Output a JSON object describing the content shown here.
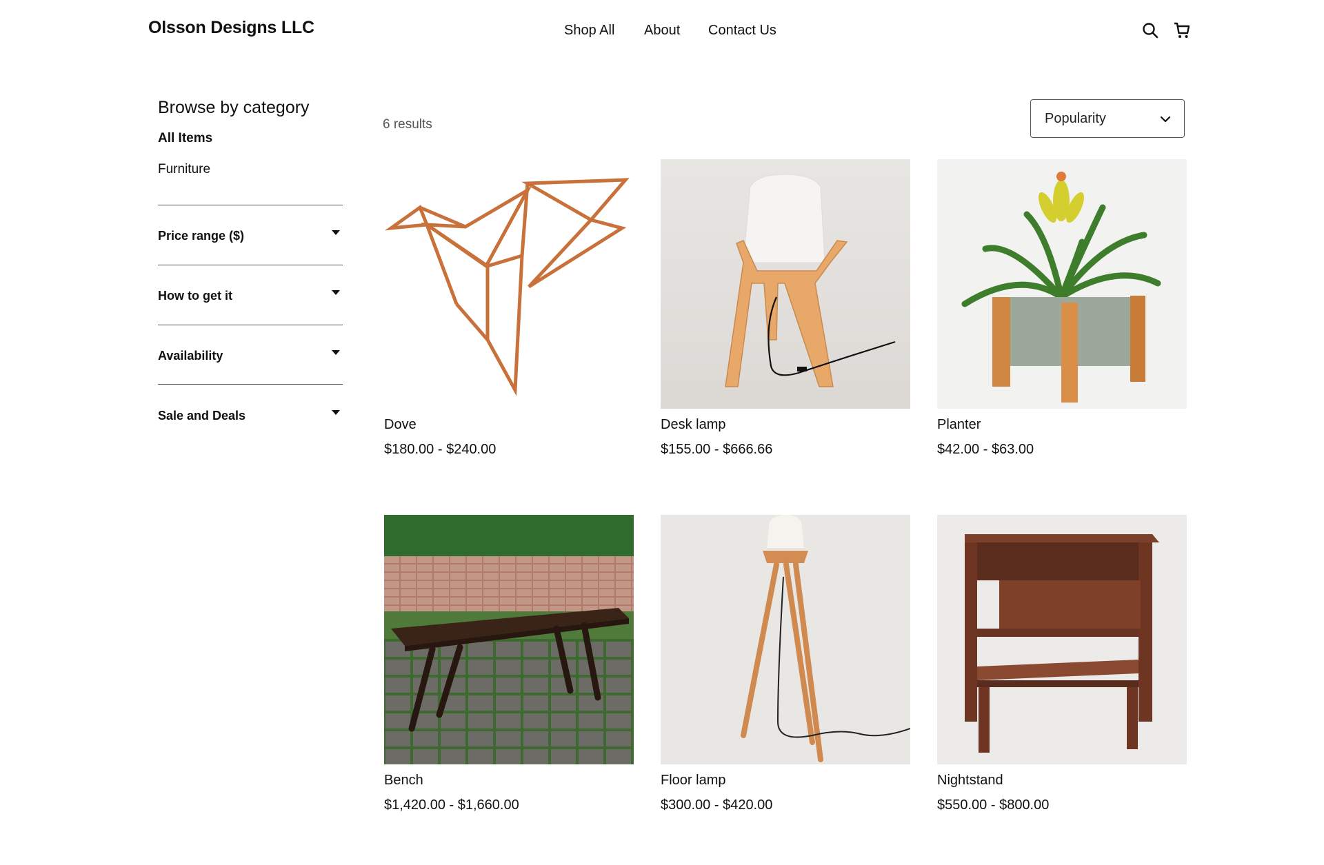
{
  "header": {
    "brand": "Olsson Designs LLC",
    "nav": [
      {
        "label": "Shop All"
      },
      {
        "label": "About"
      },
      {
        "label": "Contact Us"
      }
    ],
    "icons": [
      "search-icon",
      "cart-icon"
    ]
  },
  "sidebar": {
    "title": "Browse by category",
    "categories": [
      {
        "label": "All Items",
        "selected": true
      },
      {
        "label": "Furniture",
        "selected": false
      }
    ],
    "filters": [
      {
        "label": "Price range ($)"
      },
      {
        "label": "How to get it"
      },
      {
        "label": "Availability"
      },
      {
        "label": "Sale and Deals"
      }
    ]
  },
  "results": {
    "count_text": "6 results",
    "sort": {
      "selected": "Popularity"
    }
  },
  "products": [
    {
      "name": "Dove",
      "price": "$180.00 - $240.00"
    },
    {
      "name": "Desk lamp",
      "price": "$155.00 - $666.66"
    },
    {
      "name": "Planter",
      "price": "$42.00 - $63.00"
    },
    {
      "name": "Bench",
      "price": "$1,420.00 - $1,660.00"
    },
    {
      "name": "Floor lamp",
      "price": "$300.00 - $420.00"
    },
    {
      "name": "Nightstand",
      "price": "$550.00 - $800.00"
    }
  ],
  "colors": {
    "text": "#111111",
    "muted": "#555555",
    "wood": "#c8773a",
    "walnut": "#7a3f2a"
  }
}
